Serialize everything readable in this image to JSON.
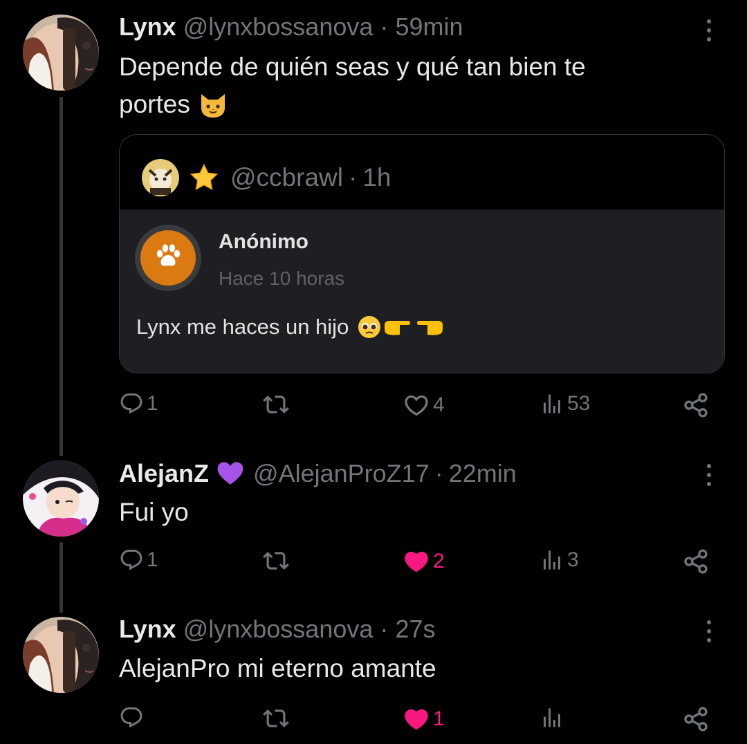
{
  "colors": {
    "background": "#000000",
    "text": "#e7e9ea",
    "muted": "#71767b",
    "like": "#f91880",
    "anon_orange": "#dc7a12"
  },
  "posts": [
    {
      "name": "Lynx",
      "handle": "@lynxbossanova",
      "separator": "·",
      "time": "59min",
      "text_line1": "Depende de quién seas y qué tan bien te",
      "text_line2": "portes",
      "emoji": "cat-face",
      "quote": {
        "badge": "star",
        "handle": "@ccbrawl",
        "separator": "·",
        "time": "1h",
        "card": {
          "name": "Anónimo",
          "time": "Hace 10 horas",
          "message": "Lynx me haces un hijo",
          "emojis": [
            "pleading-face",
            "pointing-right",
            "pointing-left"
          ]
        }
      },
      "actions": {
        "replies": "1",
        "reposts": "",
        "likes": "4",
        "views": "53",
        "liked": false
      }
    },
    {
      "name": "AlejanZ",
      "badge": "purple-heart",
      "handle": "@AlejanProZ17",
      "separator": "·",
      "time": "22min",
      "text": "Fui yo",
      "actions": {
        "replies": "1",
        "reposts": "",
        "likes": "2",
        "views": "3",
        "liked": true
      }
    },
    {
      "name": "Lynx",
      "handle": "@lynxbossanova",
      "separator": "·",
      "time": "27s",
      "text": "AlejanPro mi eterno amante",
      "actions": {
        "replies": "",
        "reposts": "",
        "likes": "1",
        "views": "",
        "liked": true
      }
    }
  ]
}
